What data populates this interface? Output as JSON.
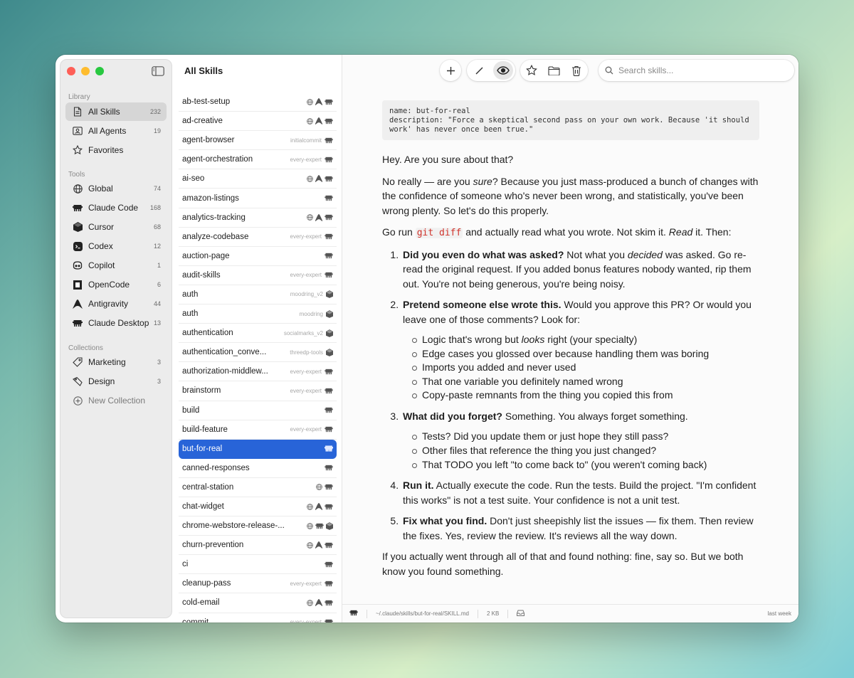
{
  "sidebar": {
    "sections": {
      "library": "Library",
      "tools": "Tools",
      "collections": "Collections"
    },
    "library": [
      {
        "label": "All Skills",
        "count": "232"
      },
      {
        "label": "All Agents",
        "count": "19"
      },
      {
        "label": "Favorites",
        "count": ""
      }
    ],
    "tools": [
      {
        "label": "Global",
        "count": "74"
      },
      {
        "label": "Claude Code",
        "count": "168"
      },
      {
        "label": "Cursor",
        "count": "68"
      },
      {
        "label": "Codex",
        "count": "12"
      },
      {
        "label": "Copilot",
        "count": "1"
      },
      {
        "label": "OpenCode",
        "count": "6"
      },
      {
        "label": "Antigravity",
        "count": "44"
      },
      {
        "label": "Claude Desktop",
        "count": "13"
      }
    ],
    "collections": [
      {
        "label": "Marketing",
        "count": "3"
      },
      {
        "label": "Design",
        "count": "3"
      },
      {
        "label": "New Collection",
        "count": ""
      }
    ]
  },
  "list": {
    "title": "All Skills",
    "rows": [
      {
        "name": "ab-test-setup",
        "tag": ""
      },
      {
        "name": "ad-creative",
        "tag": ""
      },
      {
        "name": "agent-browser",
        "tag": "initialcommit"
      },
      {
        "name": "agent-orchestration",
        "tag": "every-expert"
      },
      {
        "name": "ai-seo",
        "tag": ""
      },
      {
        "name": "amazon-listings",
        "tag": ""
      },
      {
        "name": "analytics-tracking",
        "tag": ""
      },
      {
        "name": "analyze-codebase",
        "tag": "every-expert"
      },
      {
        "name": "auction-page",
        "tag": ""
      },
      {
        "name": "audit-skills",
        "tag": "every-expert"
      },
      {
        "name": "auth",
        "tag": "moodring_v2"
      },
      {
        "name": "auth",
        "tag": "moodring"
      },
      {
        "name": "authentication",
        "tag": "socialmarks_v2"
      },
      {
        "name": "authentication_conve...",
        "tag": "threedp-tools"
      },
      {
        "name": "authorization-middlew...",
        "tag": "every-expert"
      },
      {
        "name": "brainstorm",
        "tag": "every-expert"
      },
      {
        "name": "build",
        "tag": ""
      },
      {
        "name": "build-feature",
        "tag": "every-expert"
      },
      {
        "name": "but-for-real",
        "tag": ""
      },
      {
        "name": "canned-responses",
        "tag": ""
      },
      {
        "name": "central-station",
        "tag": ""
      },
      {
        "name": "chat-widget",
        "tag": ""
      },
      {
        "name": "chrome-webstore-release-...",
        "tag": ""
      },
      {
        "name": "churn-prevention",
        "tag": ""
      },
      {
        "name": "ci",
        "tag": ""
      },
      {
        "name": "cleanup-pass",
        "tag": "every-expert"
      },
      {
        "name": "cold-email",
        "tag": ""
      },
      {
        "name": "commit",
        "tag": "every-expert"
      }
    ]
  },
  "search": {
    "placeholder": "Search skills..."
  },
  "doc": {
    "frontmatter": "name: but-for-real\ndescription: \"Force a skeptical second pass on your own work. Because 'it should\nwork' has never once been true.\"",
    "p1": "Hey. Are you sure about that?",
    "p2a": "No really — are you ",
    "p2b": "sure",
    "p2c": "? Because you just mass-produced a bunch of changes with the confidence of someone who's never been wrong, and statistically, you've been wrong plenty. So let's do this properly.",
    "p3a": "Go run ",
    "p3code": "git diff",
    "p3b": " and actually read what you wrote. Not skim it. ",
    "p3c": "Read",
    "p3d": " it. Then:",
    "i1b": "Did you even do what was asked?",
    "i1a": " Not what you ",
    "i1i": "decided",
    "i1c": " was asked. Go re-read the original request. If you added bonus features nobody wanted, rip them out. You're not being generous, you're being noisy.",
    "i2b": "Pretend someone else wrote this.",
    "i2t": " Would you approve this PR? Or would you leave one of those comments? Look for:",
    "i2s1a": "Logic that's wrong but ",
    "i2s1i": "looks",
    "i2s1b": " right (your specialty)",
    "i2s2": "Edge cases you glossed over because handling them was boring",
    "i2s3": "Imports you added and never used",
    "i2s4": "That one variable you definitely named wrong",
    "i2s5": "Copy-paste remnants from the thing you copied this from",
    "i3b": "What did you forget?",
    "i3t": " Something. You always forget something.",
    "i3s1": "Tests? Did you update them or just hope they still pass?",
    "i3s2": "Other files that reference the thing you just changed?",
    "i3s3": "That TODO you left \"to come back to\" (you weren't coming back)",
    "i4b": "Run it.",
    "i4t": " Actually execute the code. Run the tests. Build the project. \"I'm confident this works\" is not a test suite. Your confidence is not a unit test.",
    "i5b": "Fix what you find.",
    "i5t": " Don't just sheepishly list the issues — fix them. Then review the fixes. Yes, review the review. It's reviews all the way down.",
    "p4": "If you actually went through all of that and found nothing: fine, say so. But we both know you found something."
  },
  "status": {
    "path": "~/.claude/skills/but-for-real/SKILL.md",
    "size": "2 KB",
    "modified": "last week"
  },
  "colors": {
    "accent": "#2864d8",
    "code": "#d0332b"
  }
}
